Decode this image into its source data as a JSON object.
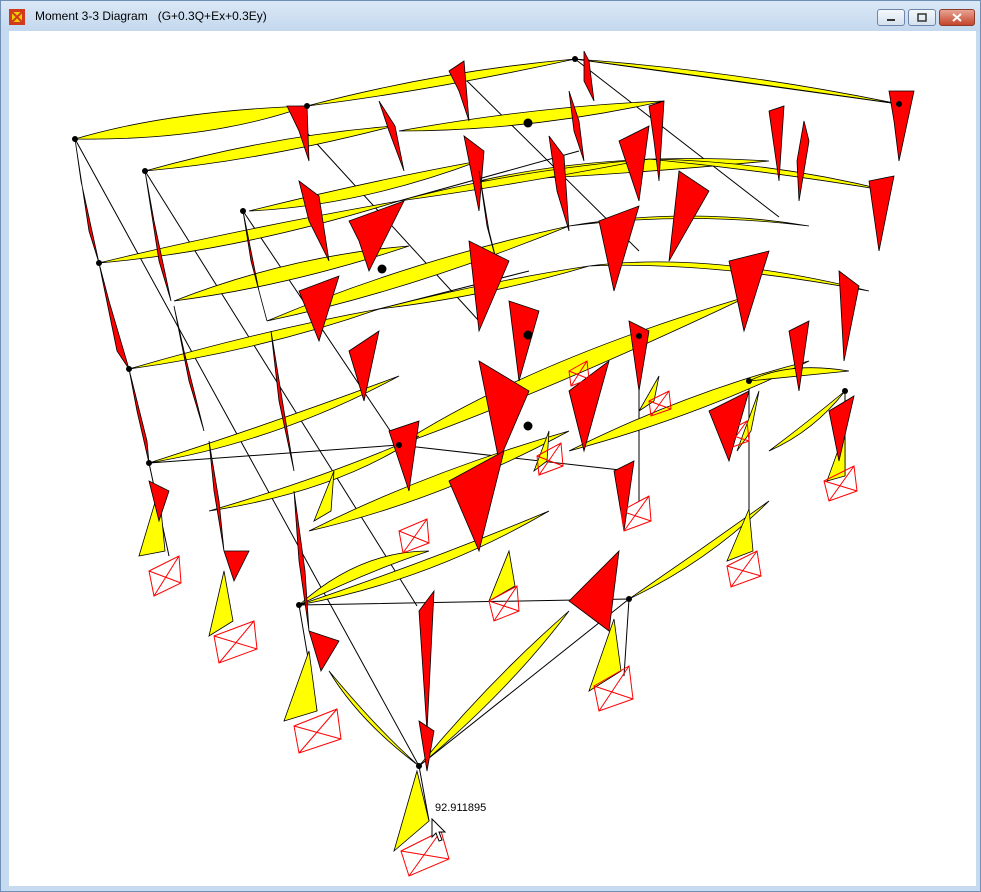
{
  "window": {
    "title": "Moment 3-3 Diagram   (G+0.3Q+Ex+0.3Ey)",
    "icon": "sap-app-icon",
    "controls": [
      "minimize",
      "maximize",
      "close"
    ]
  },
  "viewport": {
    "tooltip_value": "92.911895",
    "cursor": "arrow-cursor",
    "colors": {
      "background": "#ffffff",
      "beam_moment_fill": "#ffff00",
      "column_moment_fill": "#ff0000",
      "support_symbol": "#ff0000"
    }
  }
}
